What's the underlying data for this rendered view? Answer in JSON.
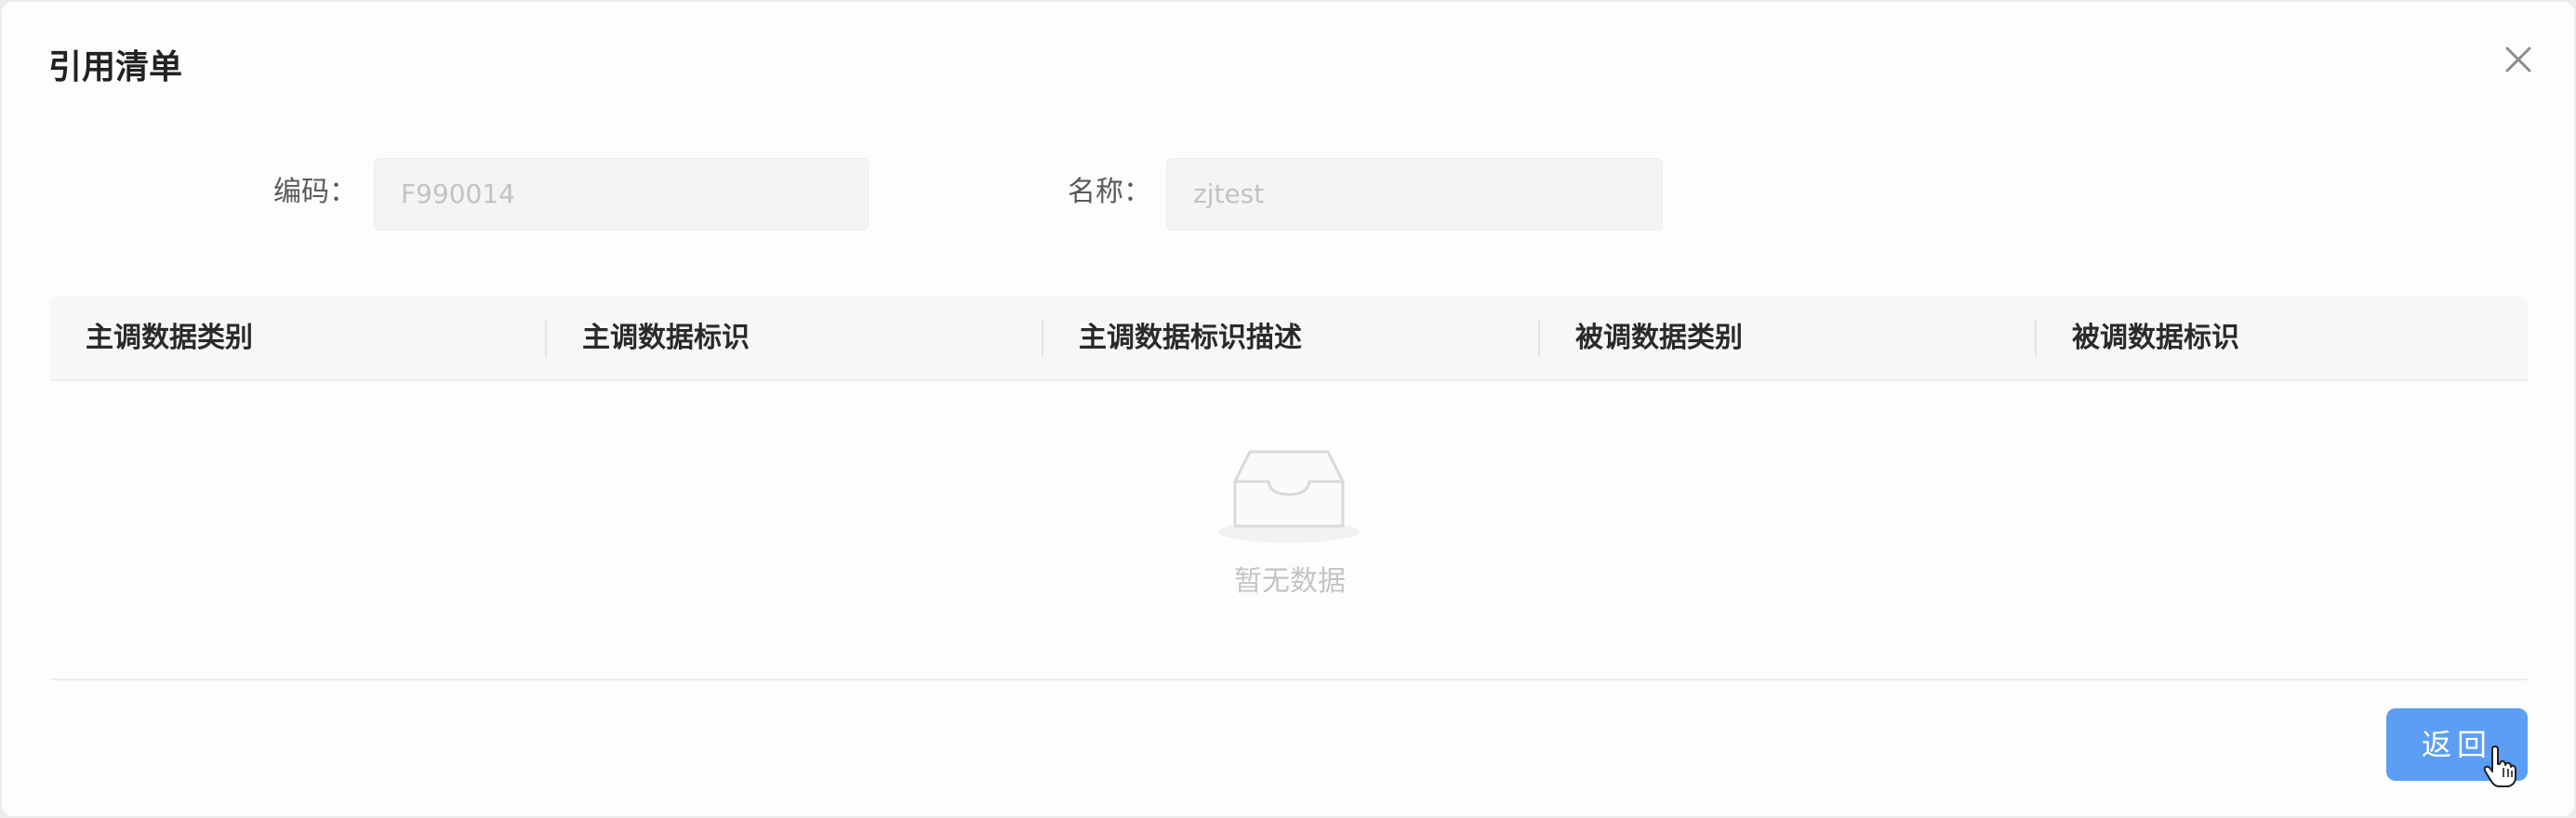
{
  "dialog": {
    "title": "引用清单",
    "close_icon": "close-icon"
  },
  "form": {
    "code_label": "编码：",
    "code_value": "F990014",
    "name_label": "名称：",
    "name_value": "zjtest"
  },
  "table": {
    "columns": [
      "主调数据类别",
      "主调数据标识",
      "主调数据标识描述",
      "被调数据类别",
      "被调数据标识"
    ],
    "rows": [],
    "empty_icon": "inbox-icon",
    "empty_text": "暂无数据"
  },
  "footer": {
    "back_label": "返回"
  },
  "colors": {
    "primary": "#5b9ef3",
    "header_bg": "#f7f7f7",
    "input_bg": "#f4f4f4"
  }
}
